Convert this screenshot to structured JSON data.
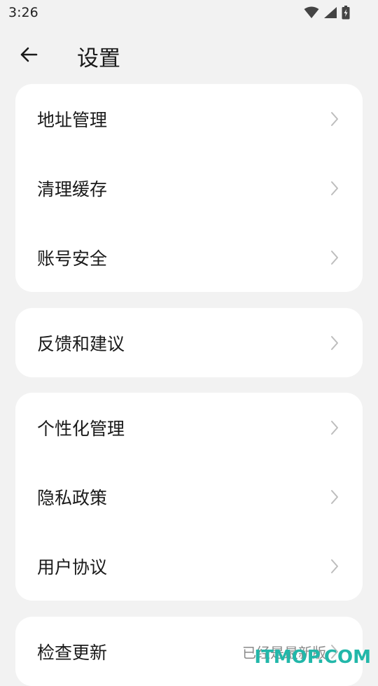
{
  "status_bar": {
    "time": "3:26",
    "icons": [
      "wifi-icon",
      "signal-icon",
      "battery-charging-icon"
    ]
  },
  "header": {
    "back_icon": "arrow-left-icon",
    "title": "设置"
  },
  "groups": [
    {
      "items": [
        {
          "label": "地址管理"
        },
        {
          "label": "清理缓存"
        },
        {
          "label": "账号安全"
        }
      ]
    },
    {
      "items": [
        {
          "label": "反馈和建议"
        }
      ]
    },
    {
      "items": [
        {
          "label": "个性化管理"
        },
        {
          "label": "隐私政策"
        },
        {
          "label": "用户协议"
        }
      ]
    },
    {
      "items": [
        {
          "label": "检查更新",
          "value": "已经是最新版"
        }
      ]
    }
  ],
  "watermark": "ITMOP.COM",
  "colors": {
    "background": "#f2f2f2",
    "card": "#ffffff",
    "chevron": "#bdbdbd",
    "watermark": "#22b7a9"
  }
}
